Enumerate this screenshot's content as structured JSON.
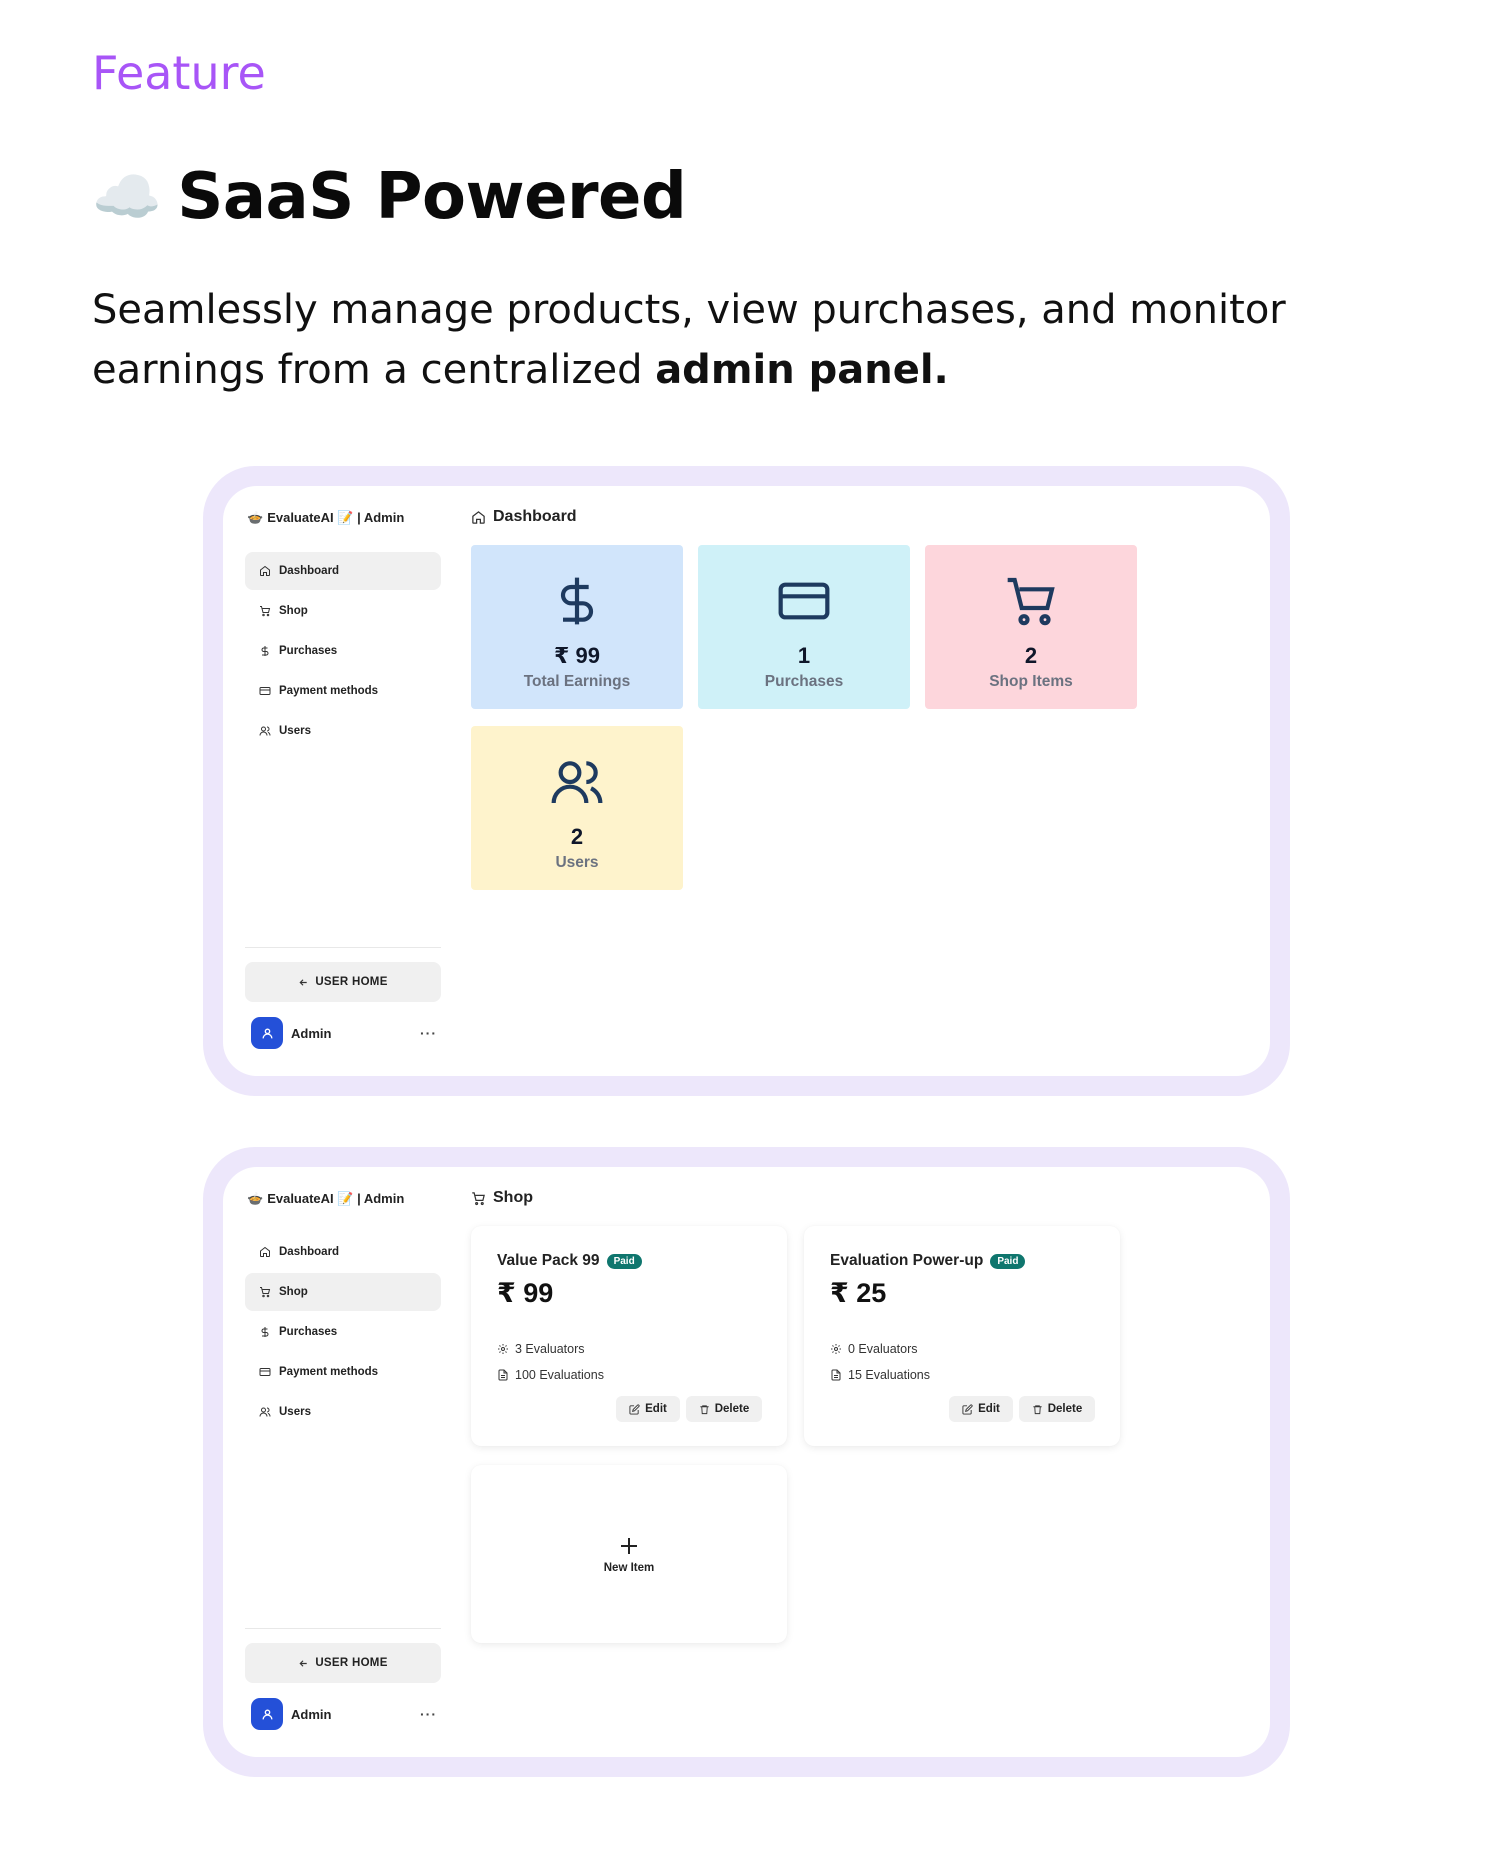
{
  "header": {
    "feature_label": "Feature",
    "title": "SaaS Powered",
    "title_emoji": "☁️",
    "description_prefix": "Seamlessly manage products, view purchases, and monitor earnings from a centralized",
    "description_bold": "admin panel."
  },
  "sidebar": {
    "brand": "EvaluateAI 📝 | Admin",
    "brand_icon": "pot-icon",
    "items": [
      {
        "label": "Dashboard",
        "icon": "home-icon"
      },
      {
        "label": "Shop",
        "icon": "cart-icon"
      },
      {
        "label": "Purchases",
        "icon": "dollar-icon"
      },
      {
        "label": "Payment methods",
        "icon": "credit-card-icon"
      },
      {
        "label": "Users",
        "icon": "users-icon"
      }
    ],
    "user_home_label": "USER HOME",
    "user_name": "Admin",
    "more_label": "···"
  },
  "dashboard": {
    "title": "Dashboard",
    "active_item": "Dashboard",
    "stats": [
      {
        "value": "₹ 99",
        "label": "Total Earnings",
        "icon": "dollar-icon",
        "color": "#d1e5fb"
      },
      {
        "value": "1",
        "label": "Purchases",
        "icon": "credit-card-icon",
        "color": "#cff1f8"
      },
      {
        "value": "2",
        "label": "Shop Items",
        "icon": "cart-icon",
        "color": "#fdd6dc"
      },
      {
        "value": "2",
        "label": "Users",
        "icon": "users-icon",
        "color": "#fef3cc"
      }
    ]
  },
  "shop": {
    "title": "Shop",
    "active_item": "Shop",
    "items": [
      {
        "name": "Value Pack 99",
        "badge": "Paid",
        "price": "₹ 99",
        "evaluators": "3 Evaluators",
        "evaluations": "100 Evaluations"
      },
      {
        "name": "Evaluation Power-up",
        "badge": "Paid",
        "price": "₹ 25",
        "evaluators": "0 Evaluators",
        "evaluations": "15 Evaluations"
      }
    ],
    "edit_label": "Edit",
    "delete_label": "Delete",
    "new_item_label": "New Item"
  },
  "colors": {
    "accent": "#a855f7",
    "frame": "#ede7fb",
    "avatar": "#2450d8",
    "badge": "#0f766e"
  }
}
